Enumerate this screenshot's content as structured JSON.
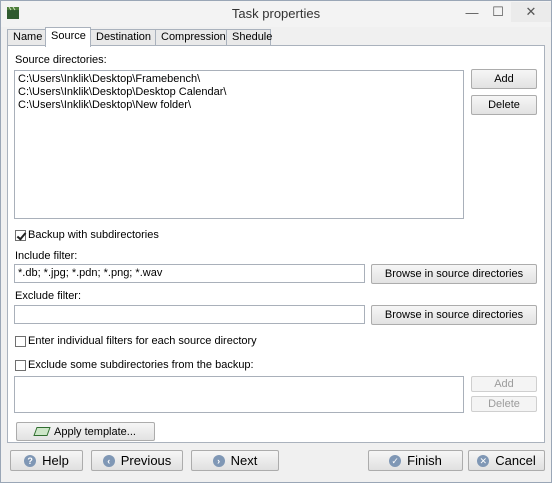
{
  "window": {
    "title": "Task properties",
    "minimize_glyph": "—",
    "maximize_glyph": "☐",
    "close_glyph": "✕"
  },
  "tabs": [
    {
      "label": "Name",
      "active": false
    },
    {
      "label": "Source",
      "active": true
    },
    {
      "label": "Destination",
      "active": false
    },
    {
      "label": "Compression",
      "active": false
    },
    {
      "label": "Shedule",
      "active": false
    }
  ],
  "source": {
    "label": "Source directories:",
    "directories": [
      "C:\\Users\\Inklik\\Desktop\\Framebench\\",
      "C:\\Users\\Inklik\\Desktop\\Desktop Calendar\\",
      "C:\\Users\\Inklik\\Desktop\\New folder\\"
    ],
    "add_label": "Add",
    "delete_label": "Delete"
  },
  "options": {
    "backup_subdirs_label": "Backup with subdirectories",
    "backup_subdirs_checked": true,
    "include_filter_label": "Include filter:",
    "include_filter_value": "*.db; *.jpg; *.pdn; *.png; *.wav",
    "include_browse_label": "Browse in source directories",
    "exclude_filter_label": "Exclude filter:",
    "exclude_filter_value": "",
    "exclude_browse_label": "Browse in source directories",
    "individual_filters_label": "Enter individual filters for each source directory",
    "individual_filters_checked": false,
    "exclude_subdirs_label": "Exclude some subdirectories from the backup:",
    "exclude_subdirs_checked": false,
    "exclude_add_label": "Add",
    "exclude_delete_label": "Delete"
  },
  "apply_template_label": "Apply template...",
  "footer": {
    "help_label": "Help",
    "previous_label": "Previous",
    "next_label": "Next",
    "finish_label": "Finish",
    "cancel_label": "Cancel"
  },
  "colors": {
    "accent": "#7f97b5",
    "window_bg": "#f0f0f0",
    "panel_bg": "#ffffff"
  }
}
